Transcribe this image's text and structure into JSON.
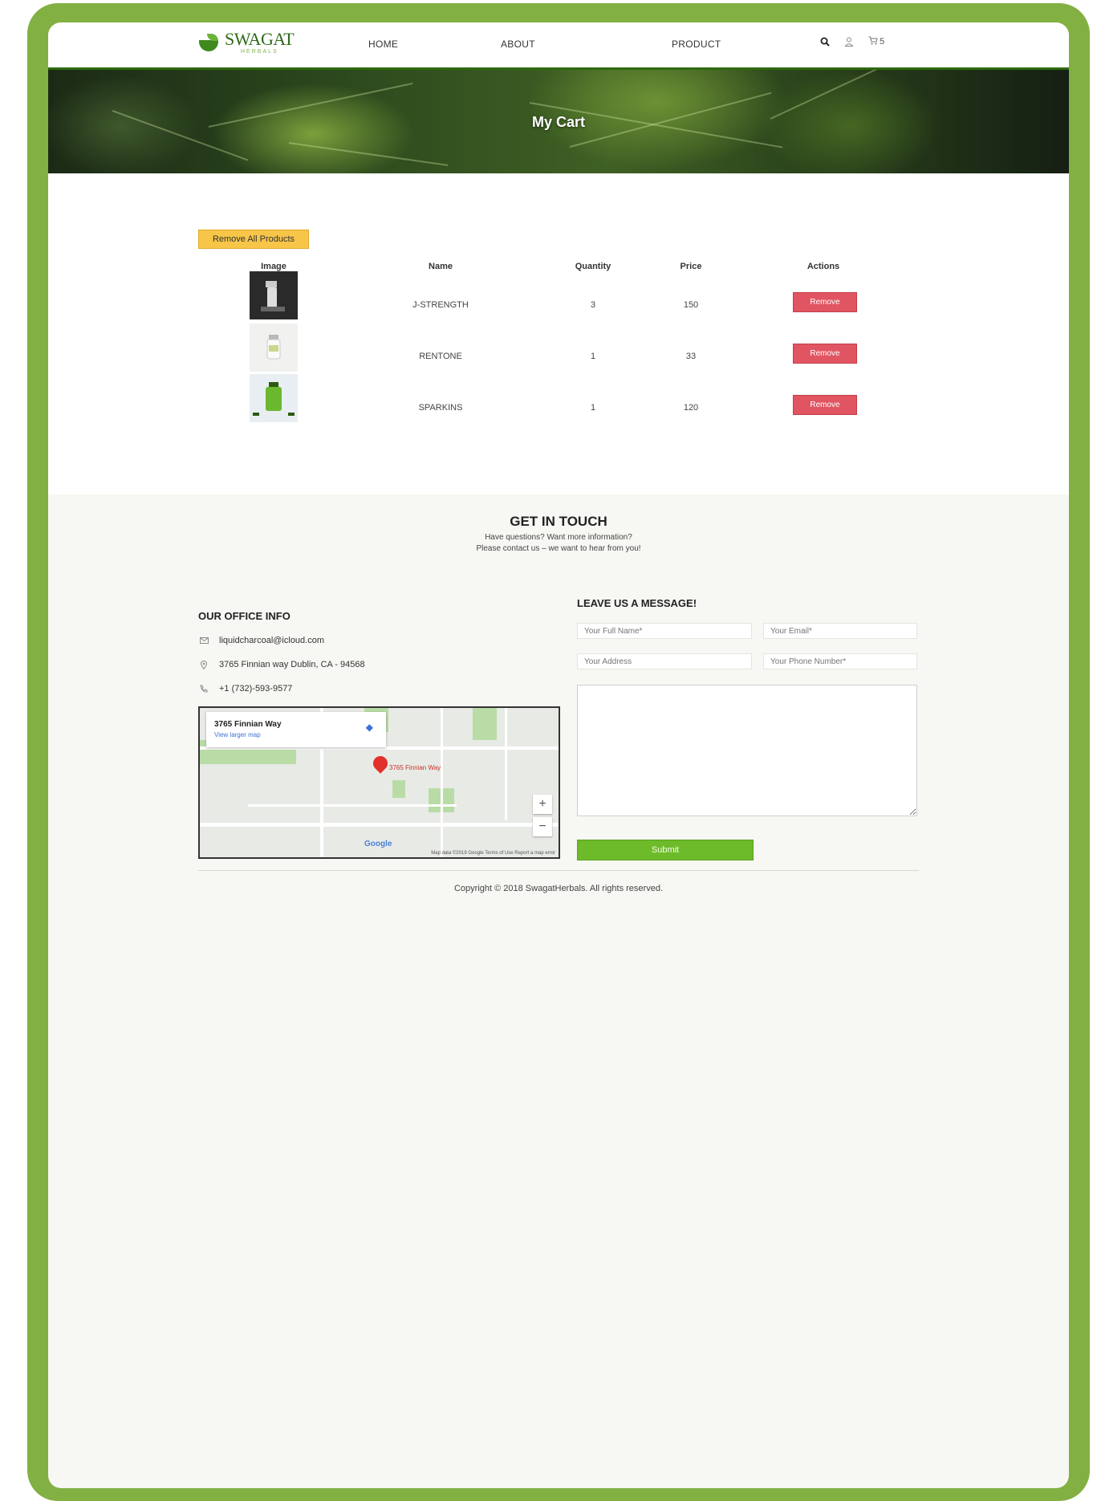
{
  "header": {
    "logo_name": "SWAGAT",
    "logo_sub": "HERBALS",
    "nav": [
      "HOME",
      "ABOUT",
      "PRODUCT"
    ],
    "cart_count": "5"
  },
  "banner": {
    "title": "My Cart"
  },
  "cart": {
    "remove_all_label": "Remove All Products",
    "columns": [
      "Image",
      "Name",
      "Quantity",
      "Price",
      "Actions"
    ],
    "rows": [
      {
        "name": "J-STRENGTH",
        "quantity": "3",
        "price": "150",
        "action": "Remove"
      },
      {
        "name": "RENTONE",
        "quantity": "1",
        "price": "33",
        "action": "Remove"
      },
      {
        "name": "SPARKINS",
        "quantity": "1",
        "price": "120",
        "action": "Remove"
      }
    ]
  },
  "contact": {
    "title": "GET IN TOUCH",
    "sub_line1": "Have questions? Want more information?",
    "sub_line2": "Please contact us – we want to hear from you!",
    "office_heading": "OUR OFFICE INFO",
    "email": "liquidcharcoal@icloud.com",
    "address": "3765 Finnian way Dublin, CA - 94568",
    "phone": "+1 (732)-593-9577",
    "map": {
      "place": "3765 Finnian Way",
      "link": "View larger map",
      "pin_label": "3765 Finnian Way",
      "google": "Google",
      "footer": "Map data ©2019 Google   Terms of Use   Report a map error"
    },
    "message_heading": "LEAVE US A MESSAGE!",
    "placeholders": {
      "full_name": "Your Full Name*",
      "email": "Your Email*",
      "address": "Your Address",
      "phone": "Your Phone Number*"
    },
    "submit_label": "Submit"
  },
  "footer": {
    "copyright": "Copyright © 2018 SwagatHerbals. All rights reserved."
  }
}
